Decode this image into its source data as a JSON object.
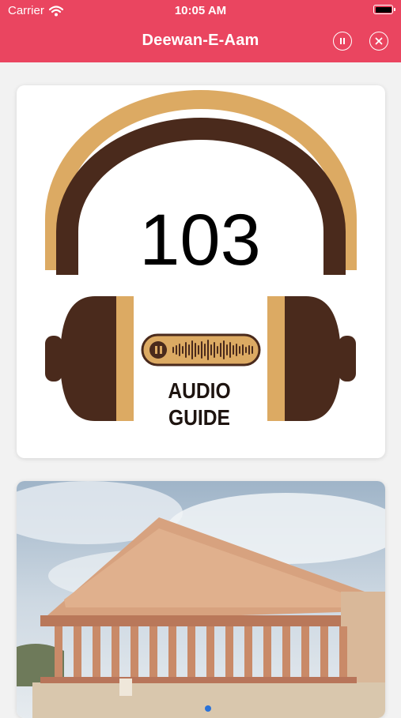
{
  "status_bar": {
    "carrier": "Carrier",
    "time": "10:05 AM"
  },
  "nav": {
    "title": "Deewan-E-Aam"
  },
  "guide": {
    "number": "103",
    "line1": "AUDIO",
    "line2": "GUIDE"
  },
  "colors": {
    "header": "#ea4560",
    "tan": "#dcaa63",
    "brown": "#4a2a1c"
  },
  "icons": [
    "wifi-icon",
    "battery-icon",
    "pause-icon",
    "close-icon"
  ]
}
